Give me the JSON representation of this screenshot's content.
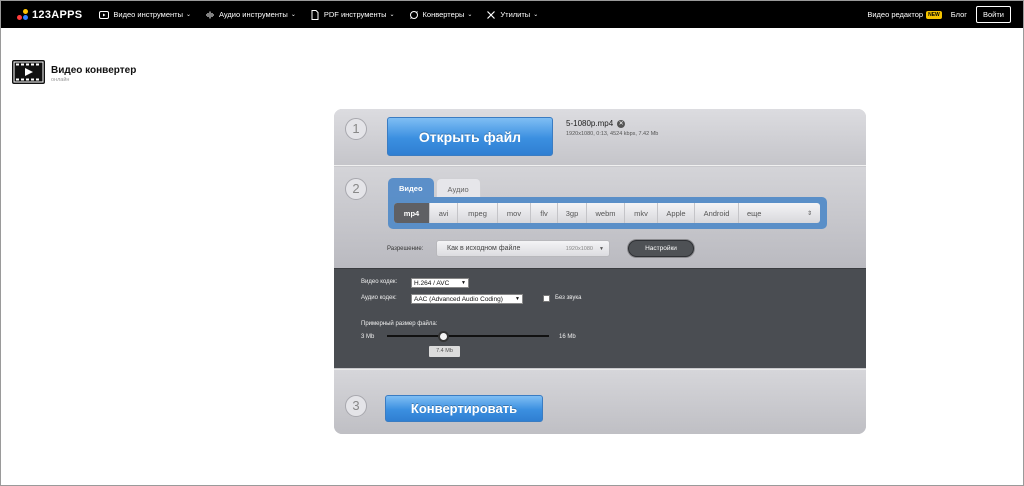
{
  "topbar": {
    "logo_text": "123APPS",
    "nav": [
      {
        "label": "Видео инструменты",
        "icon": "play-icon"
      },
      {
        "label": "Аудио инструменты",
        "icon": "audio-wave-icon"
      },
      {
        "label": "PDF инструменты",
        "icon": "pdf-file-icon"
      },
      {
        "label": "Конвертеры",
        "icon": "convert-icon"
      },
      {
        "label": "Утилиты",
        "icon": "tools-icon"
      }
    ],
    "video_editor": "Видео редактор",
    "badge_new": "NEW",
    "blog": "Блог",
    "login": "Войти"
  },
  "page": {
    "title": "Видео конвертер",
    "subtitle": "онлайн"
  },
  "step1": {
    "number": "1",
    "open_button": "Открыть файл",
    "file_name": "5-1080p.mp4",
    "file_meta": "1920x1080, 0:13, 4524 kbps, 7.42 Mb"
  },
  "step2": {
    "number": "2",
    "tabs": [
      "Видео",
      "Аудио"
    ],
    "active_tab": "Видео",
    "formats": [
      "mp4",
      "avi",
      "mpeg",
      "mov",
      "flv",
      "3gp",
      "webm",
      "mkv",
      "Apple",
      "Android"
    ],
    "active_format": "mp4",
    "more_label": "еще",
    "resolution_label": "Разрешение:",
    "resolution_value": "Как в исходном файле",
    "resolution_dim": "1920x1080",
    "settings_button": "Настройки"
  },
  "advanced": {
    "video_codec_label": "Видео кодек:",
    "video_codec_value": "H.264 / AVC",
    "audio_codec_label": "Аудио кодек:",
    "audio_codec_value": "AAC (Advanced Audio Coding)",
    "no_sound_label": "Без звука",
    "no_sound_checked": false,
    "filesize_label": "Примерный размер файла:",
    "min_label": "3 Mb",
    "max_label": "16 Mb",
    "current_label": "7.4 Mb"
  },
  "step3": {
    "number": "3",
    "convert_button": "Конвертировать"
  },
  "colors": {
    "topbar_bg": "#000000",
    "accent_blue": "#3b8fe0",
    "badge_yellow": "#f5c400",
    "dark_panel": "#4a4d52"
  }
}
